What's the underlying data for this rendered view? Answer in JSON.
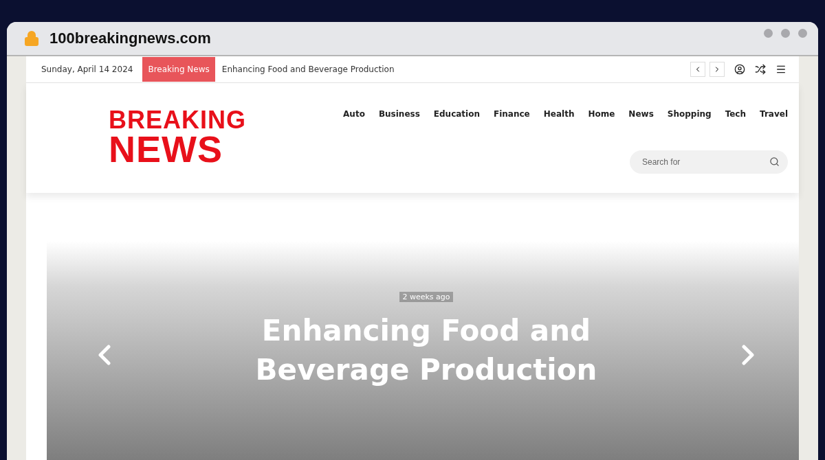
{
  "browser": {
    "address": "100breakingnews.com"
  },
  "topbar": {
    "date": "Sunday, April 14 2024",
    "ticker_label": "Breaking News",
    "ticker_headline": "Enhancing Food and Beverage Production"
  },
  "logo": {
    "line_1": "BREAKING",
    "line_2": "NEWS"
  },
  "nav": [
    "Auto",
    "Business",
    "Education",
    "Finance",
    "Health",
    "Home",
    "News",
    "Shopping",
    "Tech",
    "Travel"
  ],
  "search": {
    "placeholder": "Search for"
  },
  "hero": {
    "time": "2 weeks ago",
    "title": "Enhancing Food and Beverage Production"
  }
}
